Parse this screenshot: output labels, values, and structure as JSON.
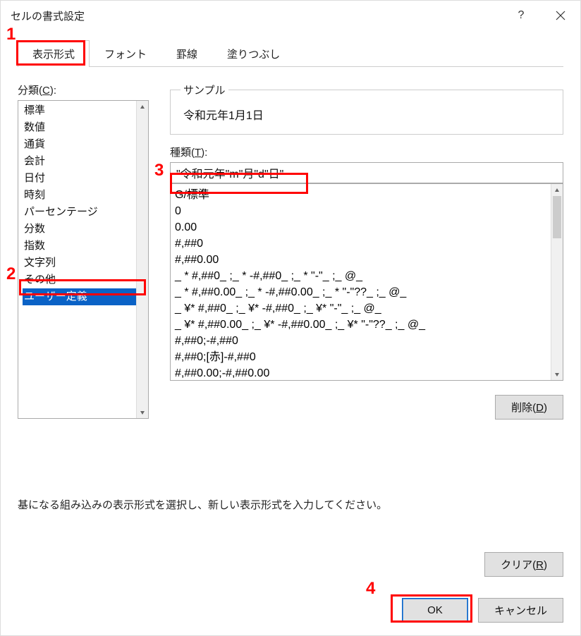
{
  "title": "セルの書式設定",
  "tabs": [
    {
      "label": "表示形式"
    },
    {
      "label": "フォント"
    },
    {
      "label": "罫線"
    },
    {
      "label": "塗りつぶし"
    }
  ],
  "category_label": "分類(",
  "category_key": "C",
  "category_close": "):",
  "categories": [
    "標準",
    "数値",
    "通貨",
    "会計",
    "日付",
    "時刻",
    "パーセンテージ",
    "分数",
    "指数",
    "文字列",
    "その他",
    "ユーザー定義"
  ],
  "selected_category_index": 11,
  "sample_label": "サンプル",
  "sample_value": "令和元年1月1日",
  "type_label": "種類(",
  "type_key": "T",
  "type_close": "):",
  "type_value": "\"令和元年\"m\"月\"d\"日\"",
  "formats": [
    "G/標準",
    "0",
    "0.00",
    "#,##0",
    "#,##0.00",
    "_ * #,##0_ ;_ * -#,##0_ ;_ * \"-\"_ ;_ @_",
    "_ * #,##0.00_ ;_ * -#,##0.00_ ;_ * \"-\"??_ ;_ @_",
    "_ ¥* #,##0_ ;_ ¥* -#,##0_ ;_ ¥* \"-\"_ ;_ @_",
    "_ ¥* #,##0.00_ ;_ ¥* -#,##0.00_ ;_ ¥* \"-\"??_ ;_ @_",
    "#,##0;-#,##0",
    "#,##0;[赤]-#,##0",
    "#,##0.00;-#,##0.00"
  ],
  "delete_label": "削除(",
  "delete_key": "D",
  "delete_close": ")",
  "hint": "基になる組み込みの表示形式を選択し、新しい表示形式を入力してください。",
  "clear_label": "クリア(",
  "clear_key": "R",
  "clear_close": ")",
  "ok_label": "OK",
  "cancel_label": "キャンセル",
  "annotations": {
    "a1": "1",
    "a2": "2",
    "a3": "3",
    "a4": "4"
  }
}
